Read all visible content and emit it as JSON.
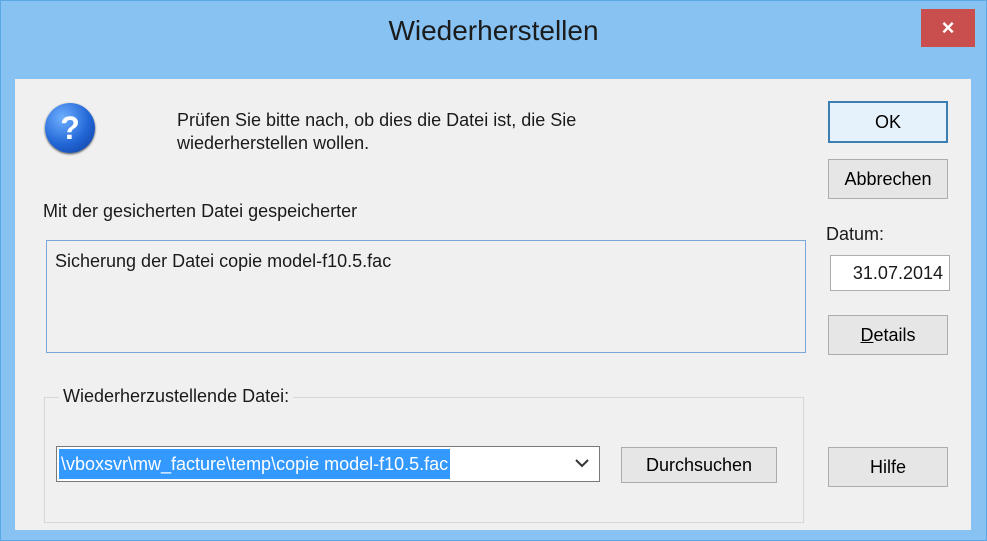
{
  "window": {
    "title": "Wiederherstellen",
    "close_glyph": "×"
  },
  "dialog": {
    "message_line1": "Prüfen Sie bitte nach, ob dies die Datei ist, die Sie",
    "message_line2": "wiederherstellen wollen.",
    "saved_with_label": "Mit der gesicherten Datei gespeicherter",
    "saved_info": "Sicherung der Datei copie model-f10.5.fac",
    "date_label": "Datum:",
    "date_value": "31.07.2014",
    "restore_file_label": "Wiederherzustellende Datei:",
    "restore_file_path": "\\vboxsvr\\mw_facture\\temp\\copie model-f10.5.fac",
    "icons": {
      "question": "question-icon",
      "dropdown": "chevron-down-icon"
    }
  },
  "buttons": {
    "ok": "OK",
    "cancel": "Abbrechen",
    "details_first": "D",
    "details_rest": "etails",
    "browse": "Durchsuchen",
    "help": "Hilfe"
  }
}
